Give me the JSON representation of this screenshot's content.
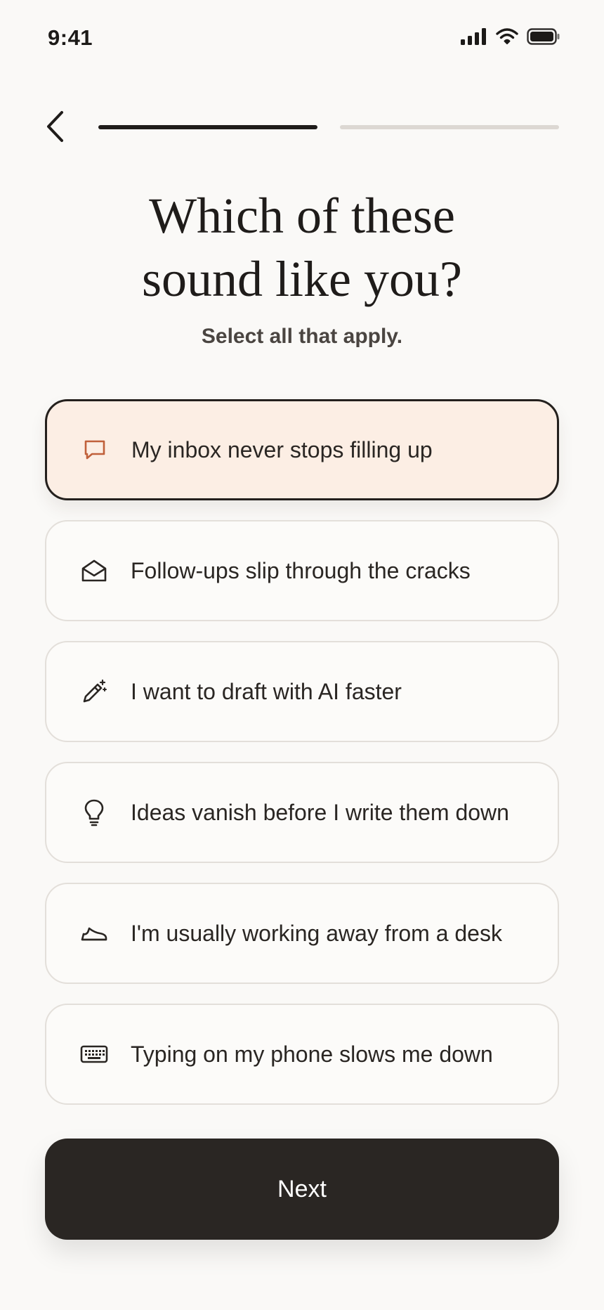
{
  "status_bar": {
    "time": "9:41",
    "icons": [
      "signal-icon",
      "wifi-icon",
      "battery-icon"
    ]
  },
  "nav": {
    "back_icon": "chevron-left-icon",
    "progress": {
      "completed_steps": 1,
      "total_steps": 2
    }
  },
  "header": {
    "title_line1": "Which of these",
    "title_line2": "sound like you?",
    "subtitle": "Select all that apply."
  },
  "options": [
    {
      "label": "My inbox never stops filling up",
      "icon": "chat-bubble-icon",
      "selected": true
    },
    {
      "label": "Follow-ups slip through the cracks",
      "icon": "open-envelope-icon",
      "selected": false
    },
    {
      "label": "I want to draft with AI faster",
      "icon": "magic-pen-icon",
      "selected": false
    },
    {
      "label": "Ideas vanish before I write them down",
      "icon": "lightbulb-icon",
      "selected": false
    },
    {
      "label": "I'm usually working away from a desk",
      "icon": "sneaker-icon",
      "selected": false
    },
    {
      "label": "Typing on my phone slows me down",
      "icon": "keyboard-icon",
      "selected": false
    }
  ],
  "next_button": {
    "label": "Next"
  },
  "colors": {
    "background": "#FAF9F7",
    "text_primary": "#2A2623",
    "selected_fill": "#FCEEE4",
    "selected_border": "#24201D",
    "selected_icon": "#C0603A",
    "card_border": "#E3DFDA",
    "progress_done": "#1F1C1A",
    "progress_todo": "#DCD8D3",
    "button_bg": "#2A2623"
  }
}
